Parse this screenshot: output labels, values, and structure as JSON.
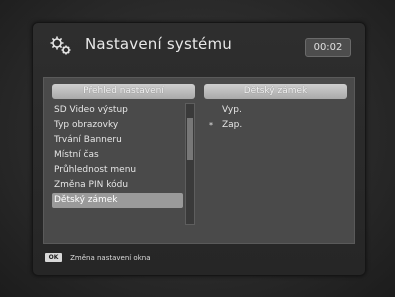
{
  "header": {
    "title": "Nastavení systému",
    "clock": "00:02",
    "icon": "gear-icon"
  },
  "settings_list": {
    "header": "Přehled nastavení",
    "items": [
      {
        "label": "SD Video výstup"
      },
      {
        "label": "Typ obrazovky"
      },
      {
        "label": "Trvání Banneru"
      },
      {
        "label": "Místní čas"
      },
      {
        "label": "Průhlednost menu"
      },
      {
        "label": "Změna PIN kódu"
      },
      {
        "label": "Dětský zámek",
        "selected": true
      }
    ]
  },
  "options": {
    "header": "Dětský zámek",
    "items": [
      {
        "label": "Vyp.",
        "marker": ""
      },
      {
        "label": "Zap.",
        "marker": "*"
      }
    ]
  },
  "footer": {
    "badge": "OK",
    "hint": "Změna nastavení okna"
  },
  "colors": {
    "panel": "#2e2e2e",
    "content": "#4a4a4a",
    "selected": "#9a9a9a",
    "header_bar": "#bdbdbd"
  }
}
